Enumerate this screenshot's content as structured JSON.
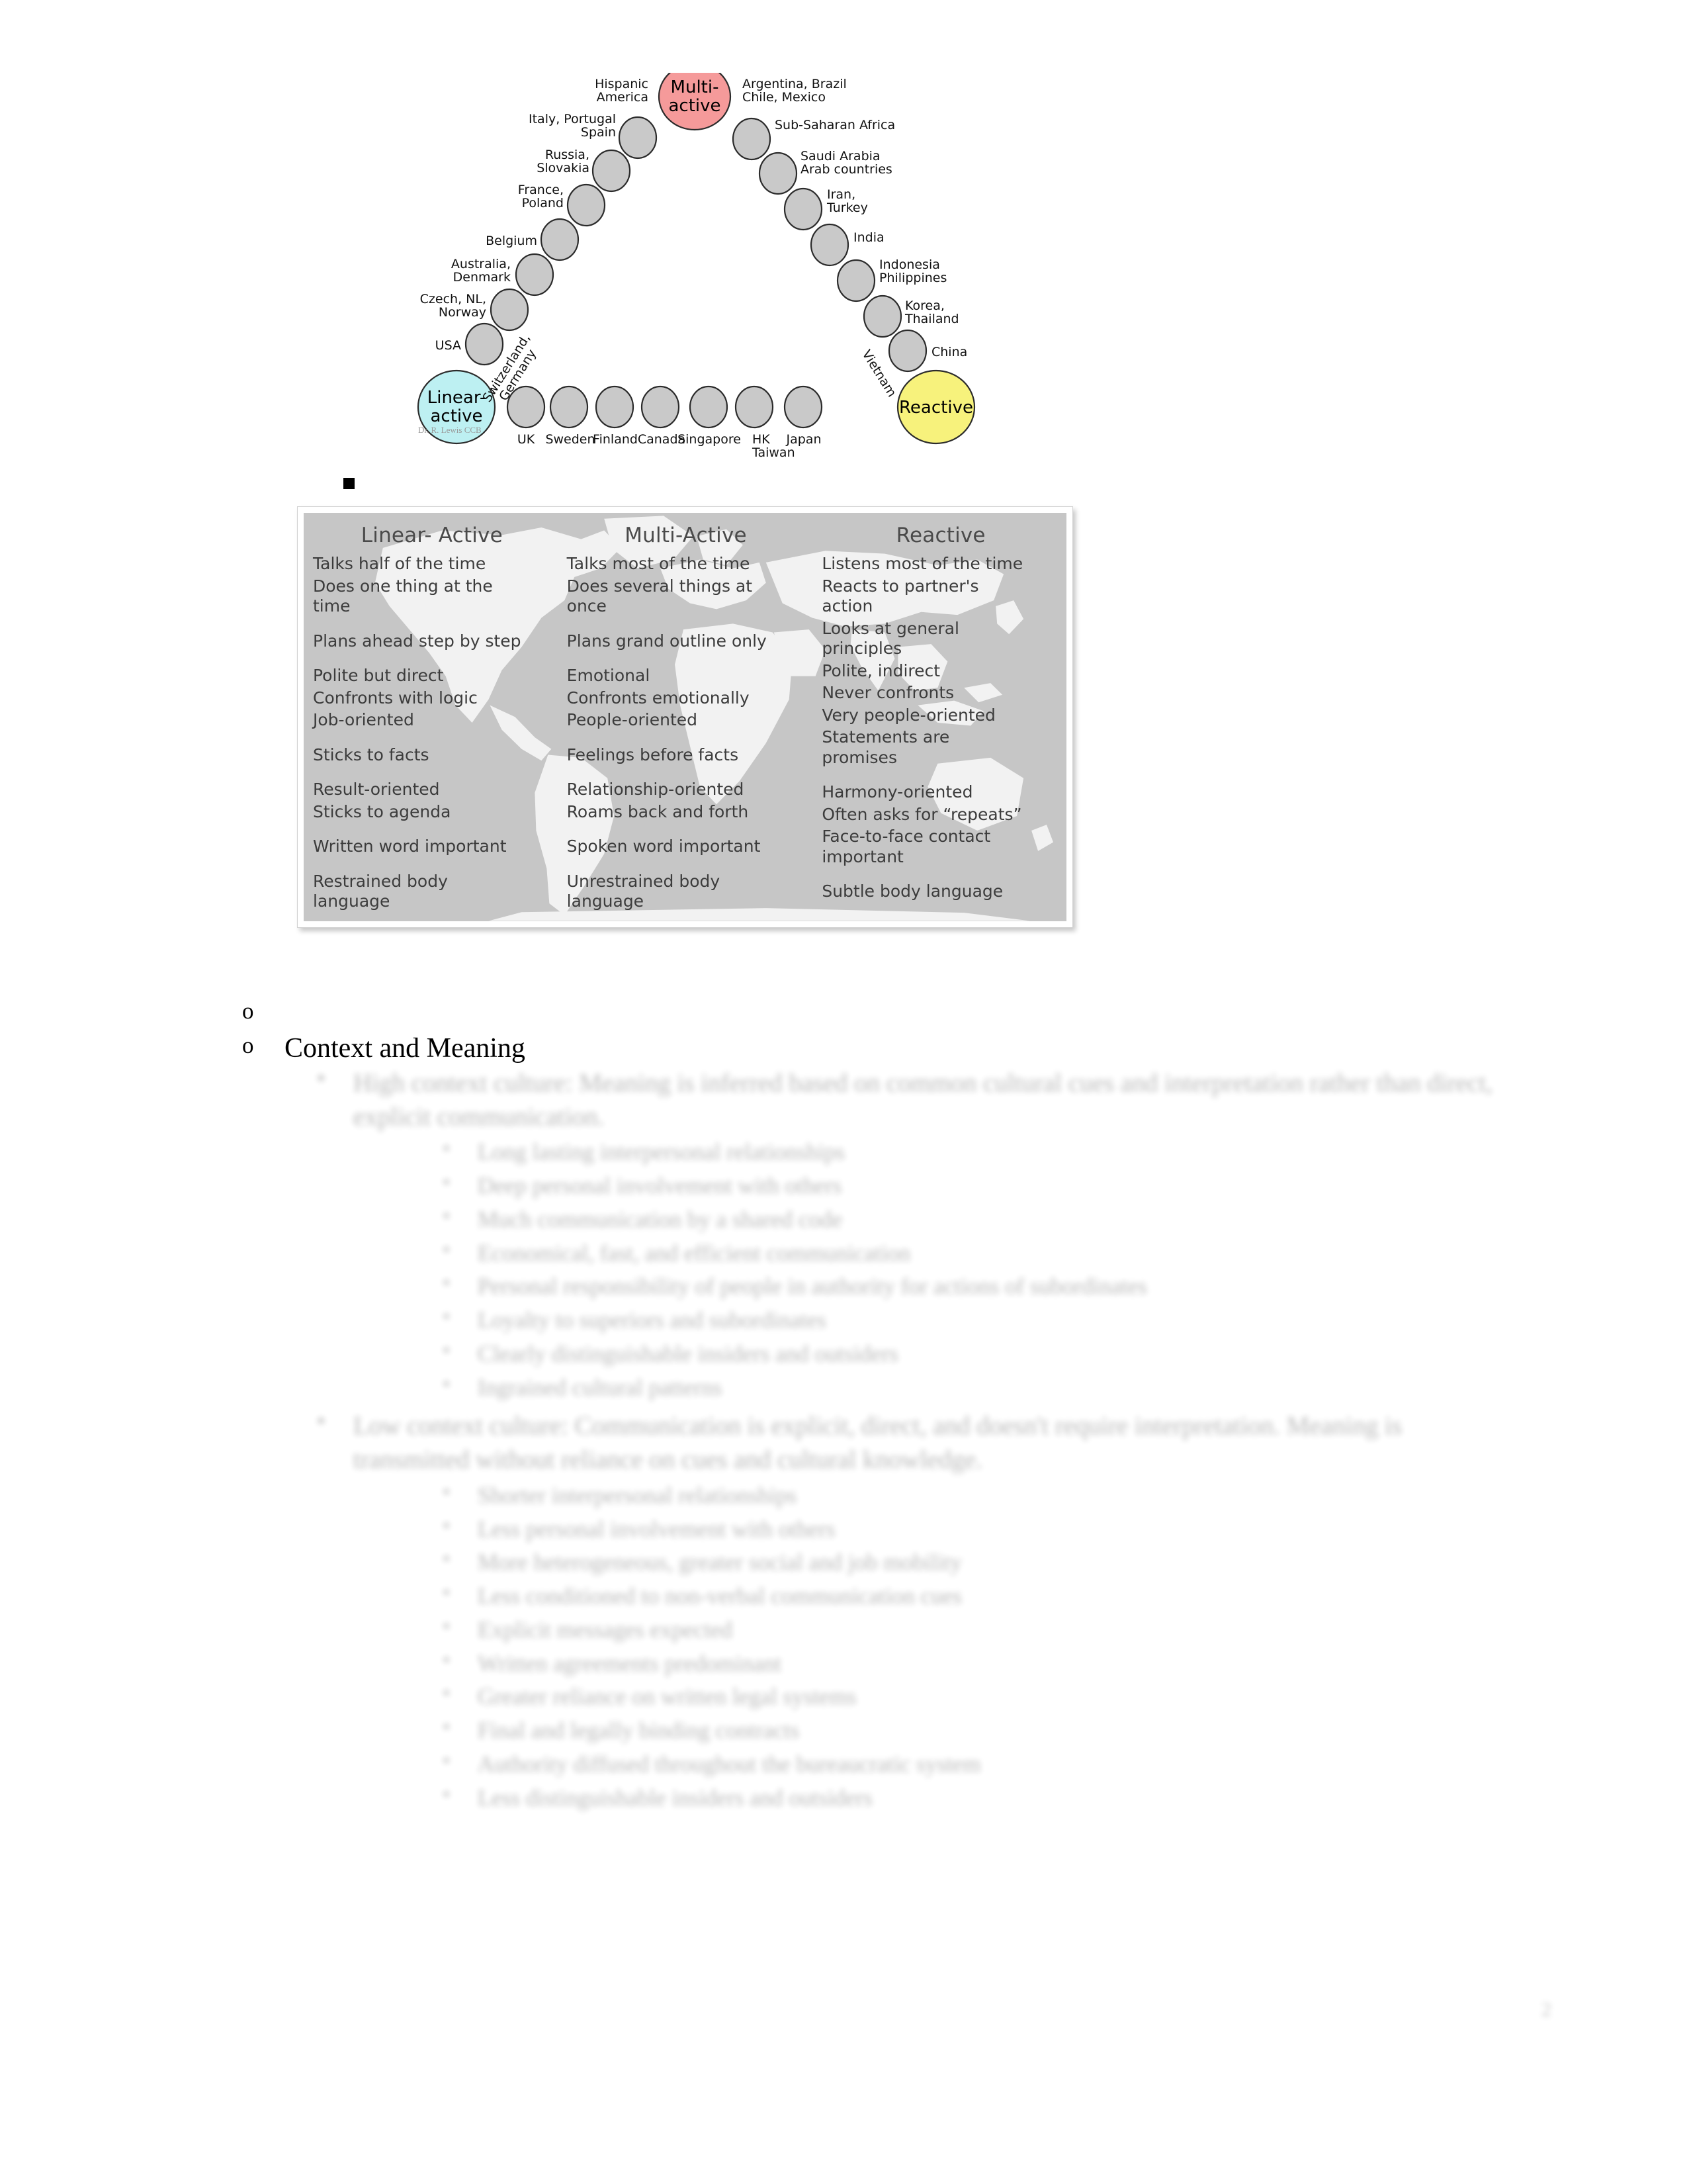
{
  "document": {
    "page_number": "2"
  },
  "diagram": {
    "name": "lewis-model-culture-triangle",
    "credit": "Dr. R. Lewis  CCB",
    "corners": [
      {
        "id": "multi-active",
        "label": "Multi-\nactive",
        "color": "#f59a9a"
      },
      {
        "id": "linear-active",
        "label": "Linear-\nactive",
        "color": "#bdf0f2"
      },
      {
        "id": "reactive",
        "label": "Reactive",
        "color": "#f7f27c"
      }
    ],
    "left_side_nodes": [
      {
        "label": "Hispanic\nAmerica"
      },
      {
        "label": "Italy, Portugal\nSpain"
      },
      {
        "label": "Russia,\nSlovakia"
      },
      {
        "label": "France,\nPoland"
      },
      {
        "label": "Belgium"
      },
      {
        "label": "Australia,\nDenmark"
      },
      {
        "label": "Czech, NL,\nNorway"
      },
      {
        "label": "USA"
      },
      {
        "label": "Switzerland,\nGermany"
      }
    ],
    "right_side_nodes": [
      {
        "label": "Argentina, Brazil\nChile, Mexico"
      },
      {
        "label": "Sub-Saharan Africa"
      },
      {
        "label": "Saudi Arabia\nArab countries"
      },
      {
        "label": "Iran,\nTurkey"
      },
      {
        "label": "India"
      },
      {
        "label": "Indonesia\nPhilippines"
      },
      {
        "label": "Korea,\nThailand"
      },
      {
        "label": "China"
      },
      {
        "label": "Vietnam"
      }
    ],
    "bottom_nodes": [
      {
        "label": "UK"
      },
      {
        "label": "Sweden"
      },
      {
        "label": "Finland"
      },
      {
        "label": "Canada"
      },
      {
        "label": "Singapore"
      },
      {
        "label": "HK\nTaiwan"
      },
      {
        "label": "Japan"
      }
    ]
  },
  "comparison_table": {
    "columns": [
      {
        "header": "Linear- Active",
        "groups": [
          [
            "Talks half of the time",
            "Does one thing at the\ntime"
          ],
          [
            "Plans ahead step by step"
          ],
          [
            "Polite but direct",
            "Confronts with logic",
            "Job-oriented"
          ],
          [
            "Sticks to facts"
          ],
          [
            "Result-oriented",
            "Sticks to agenda"
          ],
          [
            "Written word important"
          ],
          [
            "Restrained body\nlanguage"
          ]
        ]
      },
      {
        "header": "Multi-Active",
        "groups": [
          [
            "Talks most of the time",
            "Does several things at\nonce"
          ],
          [
            "Plans grand outline only"
          ],
          [
            "Emotional",
            "Confronts emotionally",
            "People-oriented"
          ],
          [
            "Feelings before facts"
          ],
          [
            "Relationship-oriented",
            "Roams back and forth"
          ],
          [
            "Spoken word important"
          ],
          [
            "Unrestrained body\nlanguage"
          ]
        ]
      },
      {
        "header": "Reactive",
        "groups": [
          [
            "Listens most of the time",
            "Reacts to partner's\naction",
            "Looks at general\nprinciples",
            "Polite, indirect",
            "Never confronts",
            "Very people-oriented",
            "Statements are\npromises"
          ],
          [
            "Harmony-oriented",
            "Often asks for “repeats”",
            "Face-to-face contact\nimportant"
          ],
          [
            "Subtle body language"
          ]
        ]
      }
    ]
  },
  "outline": {
    "empty_bullet": "o",
    "context_bullet": "o",
    "context_heading": "Context and Meaning"
  },
  "redacted_body": {
    "note_visible": false,
    "sections": [
      {
        "marker": "▪",
        "text": "High context culture: Meaning is inferred based on common cultural cues and interpretation rather than direct, explicit communication.",
        "subitems": [
          "Long lasting interpersonal relationships",
          "Deep personal involvement with others",
          "Much communication by a shared code",
          "Economical, fast, and efficient communication",
          "Personal responsibility of people in authority for actions of subordinates",
          "Loyalty to superiors and subordinates",
          "Clearly distinguishable insiders and outsiders",
          "Ingrained cultural patterns"
        ]
      },
      {
        "marker": "▪",
        "text": "Low context culture: Communication is explicit, direct, and doesn't require interpretation. Meaning is transmitted without reliance on cues and cultural knowledge.",
        "subitems": [
          "Shorter interpersonal relationships",
          "Less personal involvement with others",
          "More heterogeneous, greater social and job mobility",
          "Less conditioned to non-verbal communication cues",
          "Explicit messages expected",
          "Written agreements predominant",
          "Greater reliance on written legal systems",
          "Final and legally binding contracts",
          "Authority diffused throughout the bureaucratic system",
          "Less distinguishable insiders and outsiders"
        ]
      }
    ]
  }
}
